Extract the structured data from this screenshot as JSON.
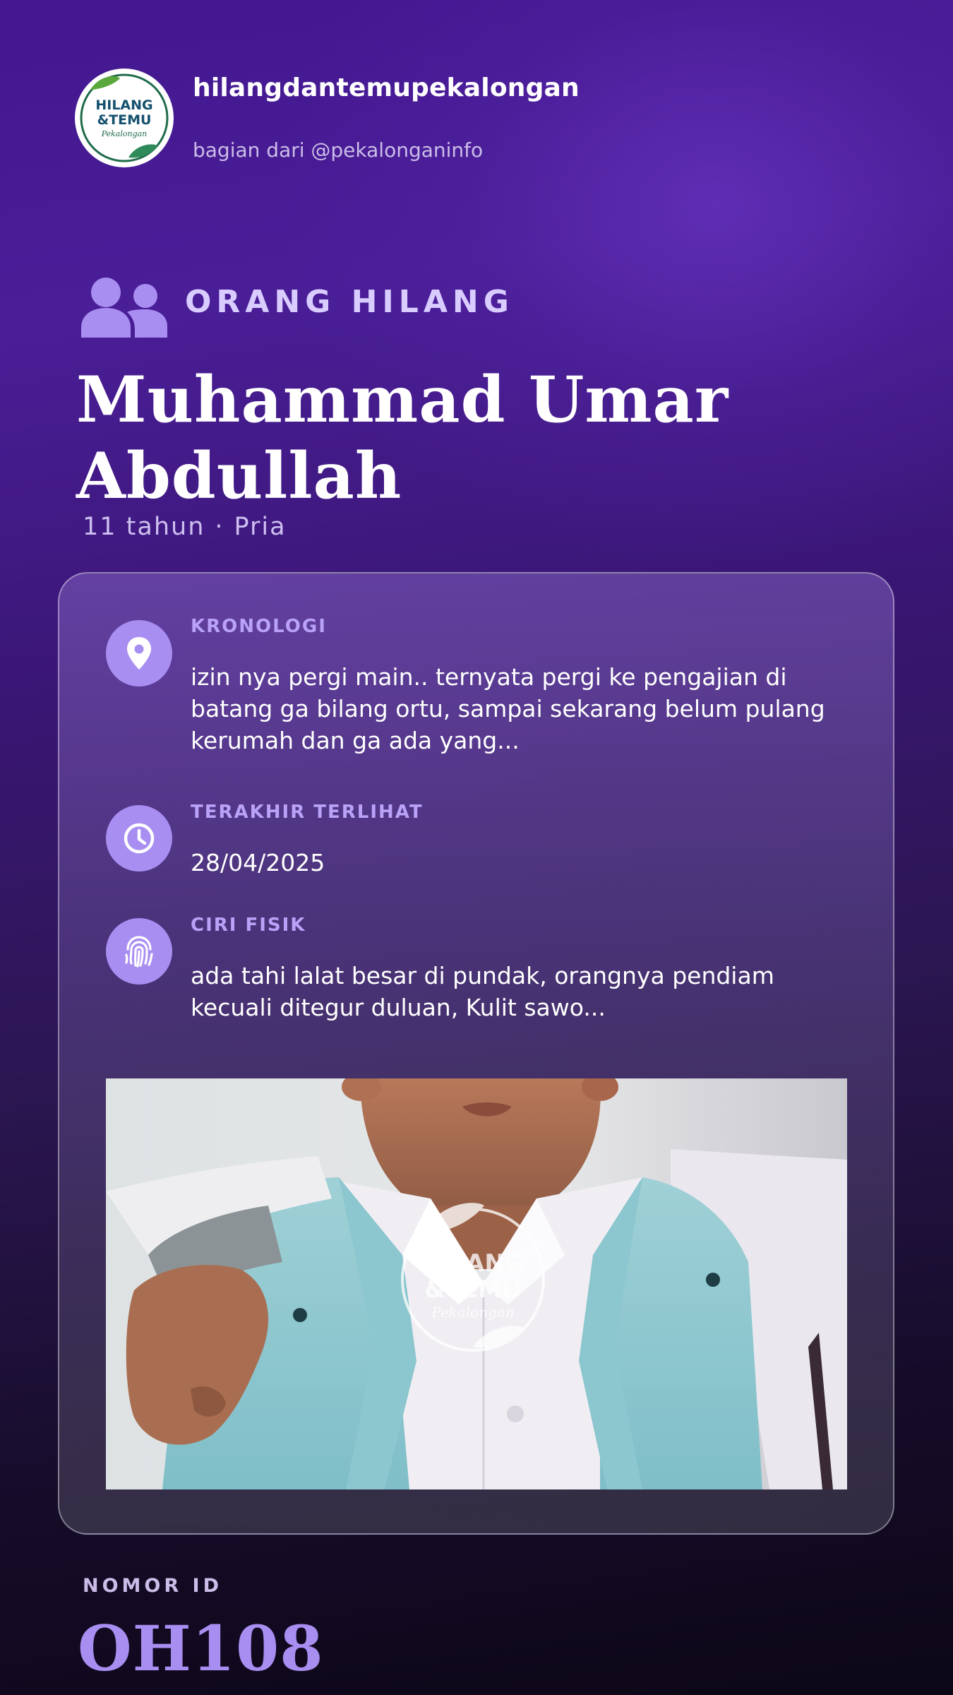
{
  "header": {
    "handle": "hilangdantemupekalongan",
    "subtitle": "bagian dari @pekalonganinfo",
    "logo_text": [
      "HILANG",
      "&TEMU",
      "Pekalongan"
    ],
    "logo_icon": "hilang-temu-logo"
  },
  "category": {
    "label": "ORANG HILANG",
    "icon": "users-icon"
  },
  "person": {
    "name": "Muhammad Umar Abdullah",
    "age": "11 tahun",
    "separator": "·",
    "gender": "Pria"
  },
  "details": [
    {
      "icon": "location-pin-icon",
      "label": "KRONOLOGI",
      "text": "izin nya pergi main.. ternyata pergi ke pengajian di batang ga bilang ortu, sampai sekarang belum pulang kerumah dan ga ada yang..."
    },
    {
      "icon": "clock-icon",
      "label": "TERAKHIR TERLIHAT",
      "text": "28/04/2025"
    },
    {
      "icon": "fingerprint-icon",
      "label": "CIRI FISIK",
      "text": "ada tahi lalat besar di pundak, orangnya pendiam kecuali ditegur duluan, Kulit sawo..."
    }
  ],
  "photo": {
    "watermark": [
      "HILANG",
      "&TEMU",
      "Pekalongan"
    ]
  },
  "footer": {
    "id_label": "NOMOR ID",
    "id_value": "OH108"
  },
  "colors": {
    "accent": "#a98ef2",
    "label": "#b9a2f7",
    "background_top": "#4a1e97",
    "background_bottom": "#0c0716",
    "logo_green": "#1f6b4a"
  }
}
